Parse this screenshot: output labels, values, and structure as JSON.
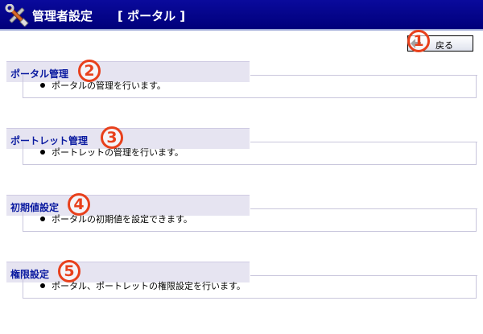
{
  "header": {
    "title": "管理者設定",
    "subtitle": "[ ポータル ]",
    "icon": "tools-icon"
  },
  "back_button": {
    "label": "戻る",
    "icon": "back-arrow-icon"
  },
  "sections": [
    {
      "badge": "1"
    },
    {
      "title": "ポータル管理",
      "description": "ポータルの管理を行います。",
      "badge": "2"
    },
    {
      "title": "ポートレット管理",
      "description": "ポートレットの管理を行います。",
      "badge": "3"
    },
    {
      "title": "初期値設定",
      "description": "ポータルの初期値を設定できます。",
      "badge": "4"
    },
    {
      "title": "権限設定",
      "description": "ポータル、ポートレットの権限設定を行います。",
      "badge": "5"
    }
  ],
  "colors": {
    "header_bg": "#00007a",
    "section_title": "#0a1aa0",
    "section_header_bg": "#e6e4f1",
    "badge": "#e8401c"
  }
}
